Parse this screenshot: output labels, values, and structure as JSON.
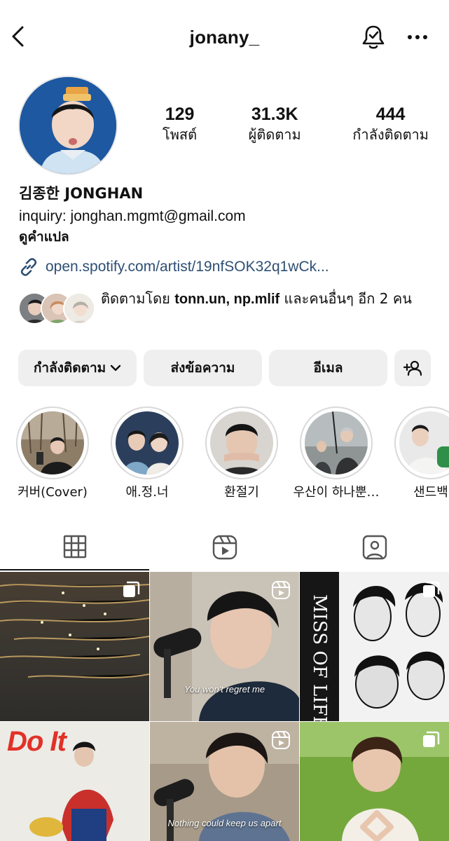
{
  "header": {
    "username": "jonany_",
    "back_icon": "chevron-left-icon",
    "bell_icon": "bell-check-icon",
    "more_icon": "ellipsis-icon"
  },
  "profile": {
    "avatar_icon": "avatar",
    "stats": [
      {
        "value": "129",
        "label": "โพสต์"
      },
      {
        "value": "31.3K",
        "label": "ผู้ติดตาม"
      },
      {
        "value": "444",
        "label": "กำลังติดตาม"
      }
    ],
    "name": "김종한 JONGHAN",
    "inquiry": "inquiry: jonghan.mgmt@gmail.com",
    "translate_label": "ดูคำแปล",
    "link": "open.spotify.com/artist/19nfSOK32q1wCk...",
    "followed_by": {
      "prefix": "ติดตามโดย ",
      "user1": "tonn.un",
      "sep": ", ",
      "user2": "np.mlif",
      "suffix": " และคนอื่นๆ อีก 2 คน"
    }
  },
  "actions": {
    "following": "กำลังติดตาม",
    "message": "ส่งข้อความ",
    "email": "อีเมล"
  },
  "highlights": [
    {
      "label": "커버(Cover)"
    },
    {
      "label": "애.정.너"
    },
    {
      "label": "환절기"
    },
    {
      "label": "우산이 하나뿐…"
    },
    {
      "label": "샌드백"
    }
  ],
  "tabs": [
    {
      "icon": "grid-icon"
    },
    {
      "icon": "reels-icon"
    },
    {
      "icon": "tagged-icon"
    }
  ],
  "posts": [
    {
      "caption": ""
    },
    {
      "caption": "You won't regret me"
    },
    {
      "caption": ""
    },
    {
      "caption": "Do It"
    },
    {
      "caption": "Nothing could keep us apart"
    },
    {
      "caption": ""
    }
  ]
}
